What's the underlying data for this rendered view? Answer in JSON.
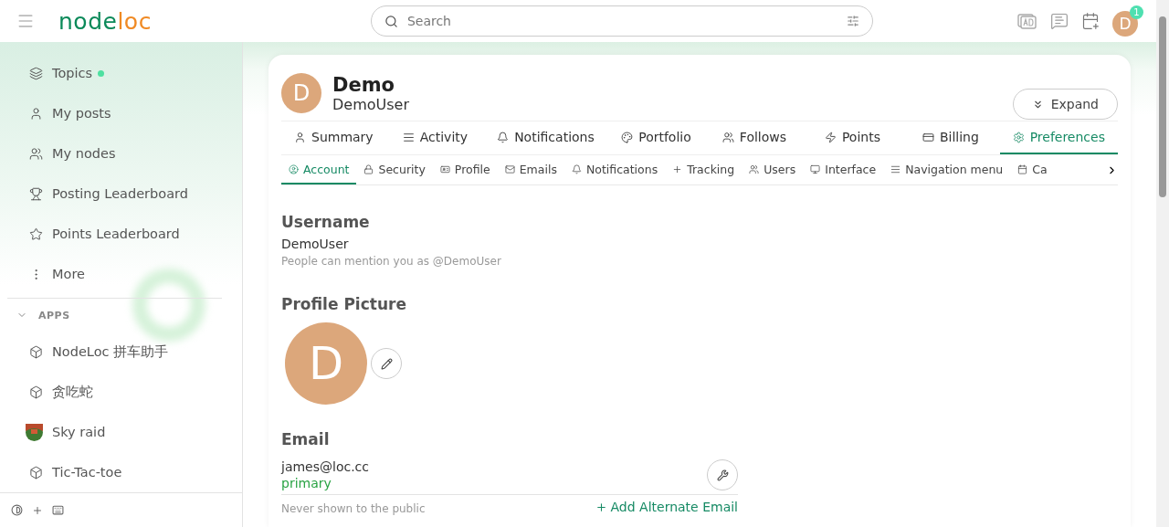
{
  "header": {
    "logo": [
      "node",
      "loc"
    ],
    "search": {
      "placeholder": "Search"
    },
    "notification_count": "1",
    "avatar_letter": "D"
  },
  "sidebar": {
    "items": [
      {
        "label": "Topics",
        "unread": true
      },
      {
        "label": "My posts",
        "unread": false
      },
      {
        "label": "My nodes",
        "unread": false
      },
      {
        "label": "Posting Leaderboard",
        "unread": false
      },
      {
        "label": "Points Leaderboard",
        "unread": false
      },
      {
        "label": "More",
        "unread": false
      }
    ],
    "section": {
      "title": "APPS",
      "expanded": true
    },
    "apps": [
      {
        "label": "NodeLoc 拼车助手",
        "kind": "app"
      },
      {
        "label": "贪吃蛇",
        "kind": "app"
      },
      {
        "label": "Sky raid",
        "kind": "picture"
      },
      {
        "label": "Tic-Tac-toe",
        "kind": "app"
      }
    ]
  },
  "profile": {
    "avatar_letter": "D",
    "name": "Demo",
    "username": "DemoUser",
    "expand_button": "Expand"
  },
  "tabs": [
    {
      "label": "Summary",
      "selected": false
    },
    {
      "label": "Activity",
      "selected": false
    },
    {
      "label": "Notifications",
      "selected": false
    },
    {
      "label": "Portfolio",
      "selected": false
    },
    {
      "label": "Follows",
      "selected": false
    },
    {
      "label": "Points",
      "selected": false
    },
    {
      "label": "Billing",
      "selected": false
    },
    {
      "label": "Preferences",
      "selected": true
    }
  ],
  "subtabs": [
    {
      "label": "Account",
      "selected": true
    },
    {
      "label": "Security",
      "selected": false
    },
    {
      "label": "Profile",
      "selected": false
    },
    {
      "label": "Emails",
      "selected": false
    },
    {
      "label": "Notifications",
      "selected": false
    },
    {
      "label": "Tracking",
      "selected": false
    },
    {
      "label": "Users",
      "selected": false
    },
    {
      "label": "Interface",
      "selected": false
    },
    {
      "label": "Navigation menu",
      "selected": false
    },
    {
      "label": "Ca",
      "selected": false
    }
  ],
  "account": {
    "username": {
      "title": "Username",
      "value": "DemoUser",
      "hint": "People can mention you as @DemoUser"
    },
    "picture": {
      "title": "Profile Picture",
      "letter": "D"
    },
    "email": {
      "title": "Email",
      "address": "james@loc.cc",
      "tag": "primary",
      "hint": "Never shown to the public",
      "add_link": "Add Alternate Email"
    }
  }
}
